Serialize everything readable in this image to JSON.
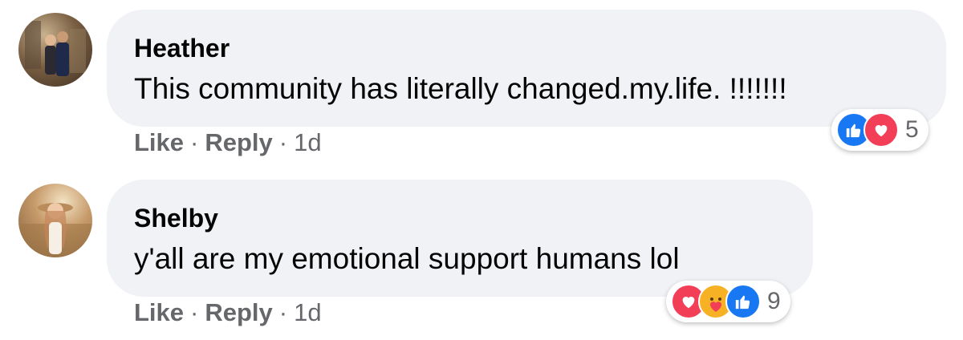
{
  "comments": [
    {
      "author": "Heather",
      "text": "This community has literally changed.my.life. !!!!!!!",
      "actions": {
        "like": "Like",
        "reply": "Reply",
        "time": "1d",
        "separator": "·"
      },
      "reactions": {
        "icons": [
          "like-icon",
          "love-icon"
        ],
        "count": "5"
      }
    },
    {
      "author": "Shelby",
      "text": "y'all are my emotional support humans lol",
      "actions": {
        "like": "Like",
        "reply": "Reply",
        "time": "1d",
        "separator": "·"
      },
      "reactions": {
        "icons": [
          "love-icon",
          "care-icon",
          "like-icon"
        ],
        "count": "9"
      }
    }
  ],
  "colors": {
    "bubble": "#f0f2f5",
    "text": "#050505",
    "secondary_text": "#65676b",
    "like": "#1877f2",
    "love": "#f33e58",
    "care": "#f7b125"
  }
}
